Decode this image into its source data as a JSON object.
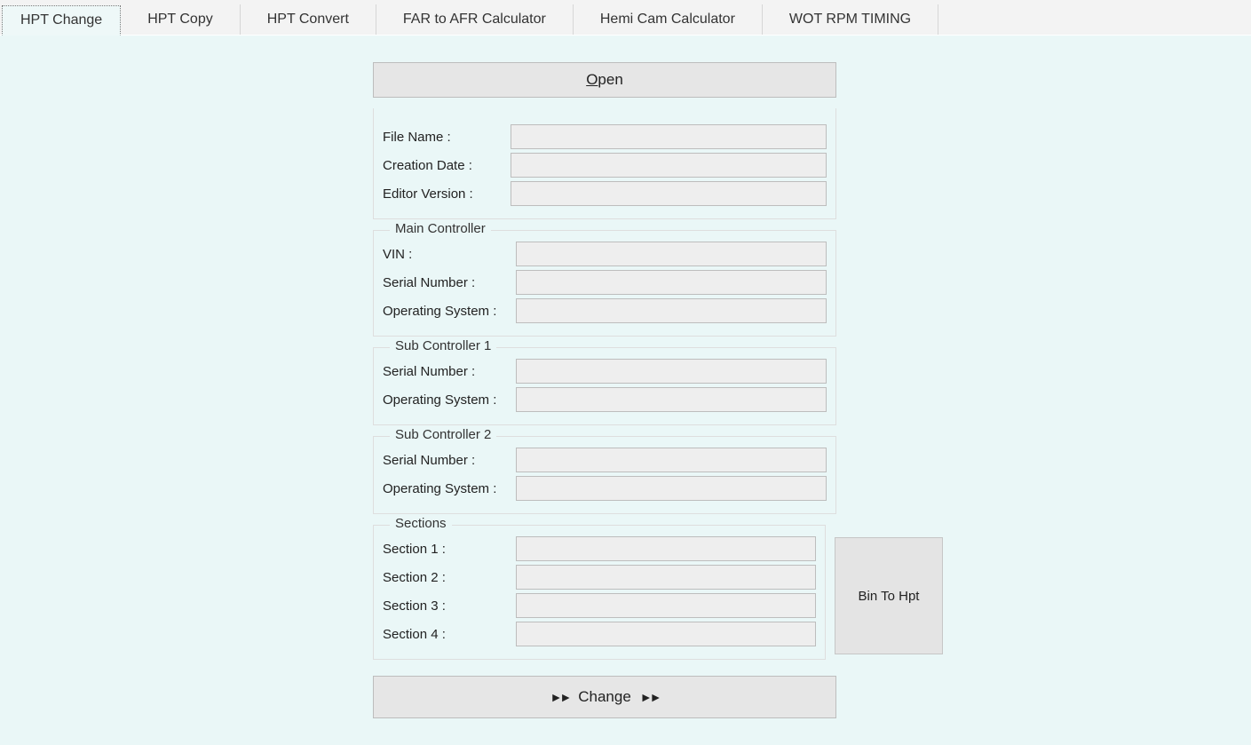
{
  "tabs": [
    {
      "label": "HPT Change",
      "active": true
    },
    {
      "label": "HPT Copy",
      "active": false
    },
    {
      "label": "HPT Convert",
      "active": false
    },
    {
      "label": "FAR to AFR Calculator",
      "active": false
    },
    {
      "label": "Hemi Cam Calculator",
      "active": false
    },
    {
      "label": "WOT RPM TIMING",
      "active": false
    }
  ],
  "buttons": {
    "open_prefix": "",
    "open_mnemonic": "O",
    "open_suffix": "pen",
    "change_prefix": "",
    "change_mnemonic": "C",
    "change_suffix": "hange",
    "bin_to_hpt": "Bin To Hpt",
    "arrows": "►►"
  },
  "fileinfo": {
    "file_name_label": "File Name :",
    "file_name_value": "",
    "creation_date_label": "Creation Date :",
    "creation_date_value": "",
    "editor_version_label": "Editor Version :",
    "editor_version_value": ""
  },
  "main_controller": {
    "legend": "Main Controller",
    "vin_label": "VIN :",
    "vin_value": "",
    "serial_label": "Serial Number :",
    "serial_value": "",
    "os_label": "Operating System :",
    "os_value": ""
  },
  "sub1": {
    "legend": "Sub Controller 1",
    "serial_label": "Serial Number :",
    "serial_value": "",
    "os_label": "Operating System :",
    "os_value": ""
  },
  "sub2": {
    "legend": "Sub Controller 2",
    "serial_label": "Serial Number :",
    "serial_value": "",
    "os_label": "Operating System :",
    "os_value": ""
  },
  "sections": {
    "legend": "Sections",
    "s1_label": "Section 1 :",
    "s1_value": "",
    "s2_label": "Section 2 :",
    "s2_value": "",
    "s3_label": "Section 3 :",
    "s3_value": "",
    "s4_label": "Section 4 :",
    "s4_value": ""
  }
}
